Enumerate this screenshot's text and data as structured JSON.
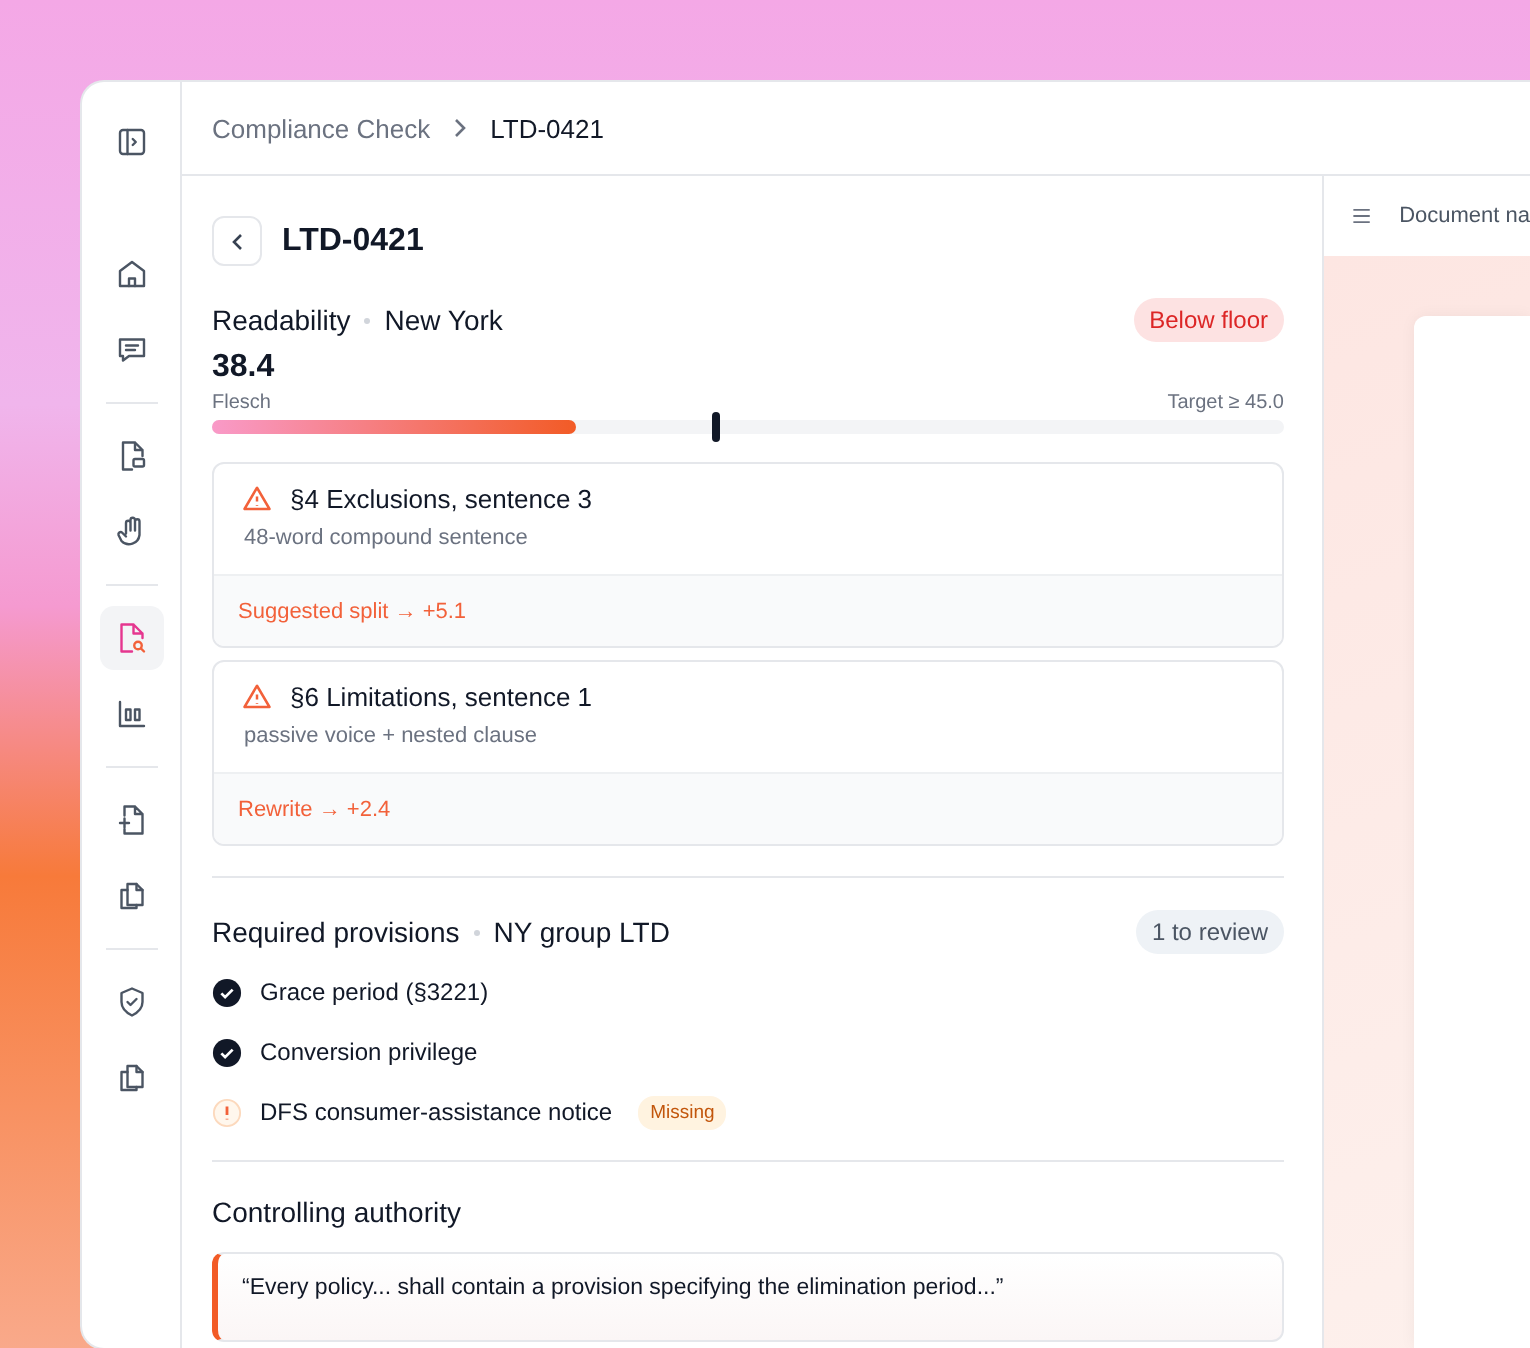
{
  "sidebar": {
    "groups": [
      {
        "items": [
          {
            "kind": "panel",
            "selected": false
          }
        ]
      },
      {
        "items": [
          {
            "kind": "home",
            "selected": false
          },
          {
            "kind": "chat",
            "selected": false
          }
        ]
      },
      {
        "items": [
          {
            "kind": "doc-chat",
            "selected": false
          },
          {
            "kind": "hand",
            "selected": false
          }
        ]
      },
      {
        "items": [
          {
            "kind": "doc-search",
            "selected": true
          },
          {
            "kind": "chart",
            "selected": false
          }
        ]
      },
      {
        "items": [
          {
            "kind": "doc-plus",
            "selected": false
          },
          {
            "kind": "copy",
            "selected": false
          }
        ]
      },
      {
        "items": [
          {
            "kind": "shield",
            "selected": false
          },
          {
            "kind": "copy",
            "selected": false
          }
        ]
      }
    ]
  },
  "breadcrumb": [
    "Compliance Check",
    "LTD-0421"
  ],
  "title": "LTD-0421",
  "readability": {
    "label": "Readability",
    "region": "New York",
    "badge": "Below floor",
    "score": "38.4",
    "score_label": "Flesch",
    "target": "Target ≥ 45.0",
    "level": 0.34,
    "target_marker": {
      "level": 0.47
    }
  },
  "issues": [
    {
      "title": "§4 Exclusions, sentence 3",
      "detail": "48-word compound sentence",
      "action": "Suggested split → +5.1"
    },
    {
      "title": "§6 Limitations, sentence 1",
      "detail": "passive voice + nested clause",
      "action": "Rewrite → +2.4"
    }
  ],
  "provisions": {
    "label": "Required provisions",
    "scope": "NY group LTD",
    "badge": "1 to review",
    "items": [
      {
        "text": "Grace period (§3221)",
        "kind": "ok"
      },
      {
        "text": "Conversion privilege",
        "kind": "ok"
      },
      {
        "text": "DFS consumer-assistance notice",
        "kind": "missing",
        "tag": "Missing"
      }
    ]
  },
  "authority": {
    "label": "Controlling authority",
    "quote": "“Every policy... shall contain a provision specifying the elimination period...”"
  },
  "document": {
    "title": "Document na"
  }
}
